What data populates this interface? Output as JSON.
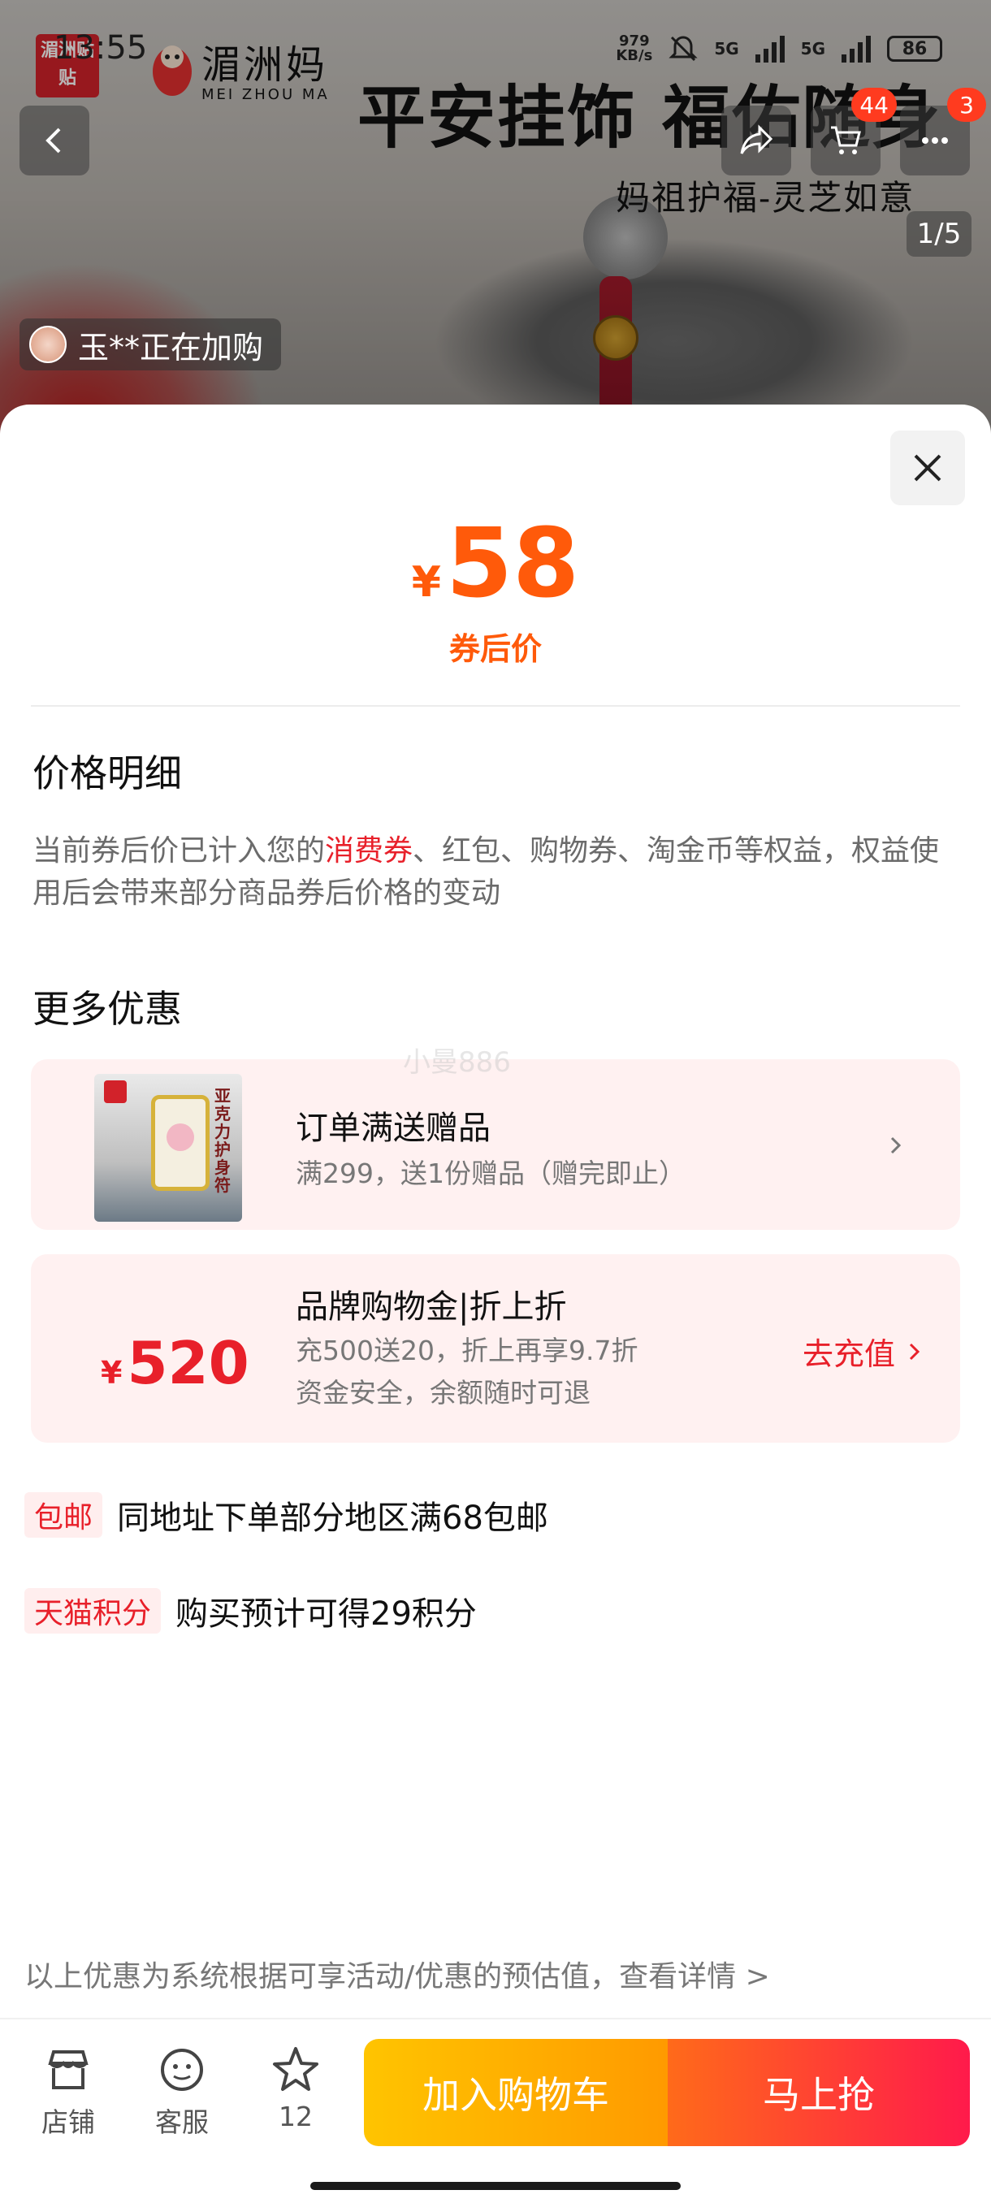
{
  "status_bar": {
    "time": "13:55",
    "net_speed_value": "979",
    "net_speed_unit": "KB/s",
    "signal_1": "5G",
    "signal_2": "5G",
    "battery": "86"
  },
  "hero": {
    "brand_logo_text": "湄洲贴贴",
    "brand_name_cn": "湄洲妈",
    "brand_name_en": "MEI ZHOU MA",
    "title": "平安挂饰 福佑随身",
    "subtitle": "妈祖护福-灵芝如意",
    "cart_badge": "44",
    "more_badge": "3",
    "page_indicator": "1/5",
    "live_buy_text": "玉**正在加购"
  },
  "sheet": {
    "price_currency": "¥",
    "price_value": "58",
    "price_label": "券后价",
    "detail_title": "价格明细",
    "detail_desc_prefix": "当前券后价已计入您的",
    "detail_desc_highlight": "消费券",
    "detail_desc_suffix": "、红包、购物券、淘金币等权益，权益使用后会带来部分商品券后价格的变动",
    "more_offers_title": "更多优惠",
    "watermark": "小曼886",
    "gift_card": {
      "image_vertical_text": "亚克力护身符",
      "title": "订单满送赠品",
      "subtitle": "满299，送1份赠品（赠完即止）"
    },
    "gold_card": {
      "currency": "¥",
      "amount": "520",
      "title": "品牌购物金|折上折",
      "line1": "充500送20，折上再享9.7折",
      "line2": "资金安全，余额随时可退",
      "action": "去充值"
    },
    "shipping": {
      "tag": "包邮",
      "text": "同地址下单部分地区满68包邮"
    },
    "points": {
      "tag": "天猫积分",
      "text": "购买预计可得29积分"
    },
    "estimate_note": "以上优惠为系统根据可享活动/优惠的预估值，查看详情 >"
  },
  "bottom_bar": {
    "shop_label": "店铺",
    "service_label": "客服",
    "favorite_count": "12",
    "add_to_cart": "加入购物车",
    "buy_now": "马上抢"
  },
  "colors": {
    "price_orange": "#ff5a0a",
    "accent_red": "#e8202a",
    "card_bg": "#fff1f1",
    "cart_gradient_start": "#ffc400",
    "buy_gradient_end": "#ff1a4b"
  }
}
